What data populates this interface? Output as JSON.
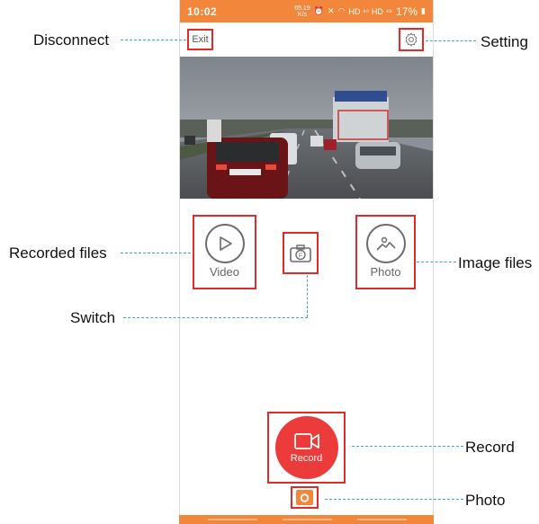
{
  "status_bar": {
    "time": "10:02",
    "speed": "65.19\nK/s",
    "signal_text": "HD ⁴⁶ HD ⁴⁶",
    "battery": "17%"
  },
  "top_bar": {
    "exit_label": "Exit"
  },
  "buttons": {
    "video_label": "Video",
    "photo_label": "Photo",
    "record_label": "Record"
  },
  "annotations": {
    "disconnect": "Disconnect",
    "setting": "Setting",
    "recorded_files": "Recorded files",
    "image_files": "Image files",
    "switch": "Switch",
    "record": "Record",
    "photo": "Photo"
  },
  "colors": {
    "accent": "#f2863a",
    "record": "#ec3b3b",
    "highlight": "#e12a2a",
    "leader": "#3aa3d8"
  },
  "icons": [
    "settings-gear-icon",
    "play-icon",
    "camera-switch-icon",
    "image-icon",
    "video-camera-icon",
    "camera-icon"
  ]
}
